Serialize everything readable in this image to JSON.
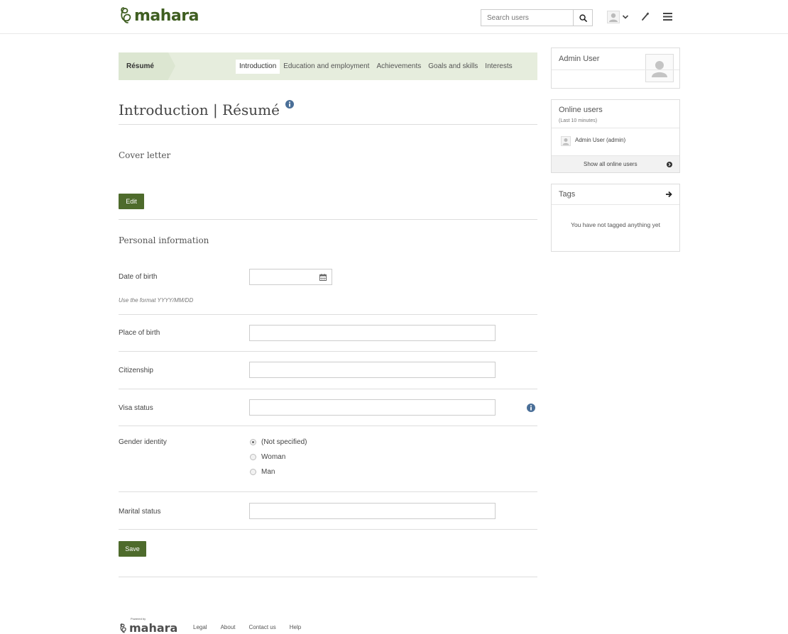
{
  "brand": {
    "name": "mahara",
    "color": "#3f5e21",
    "footer_powered_by": "Powered by",
    "footer_name": "mahara"
  },
  "header": {
    "search_placeholder": "Search users",
    "icons": [
      "search-icon",
      "user-icon",
      "chevron-down-icon",
      "wrench-icon",
      "menu-icon"
    ]
  },
  "resume_nav": {
    "label": "Résumé",
    "tabs": [
      {
        "label": "Introduction",
        "active": true
      },
      {
        "label": "Education and employment",
        "active": false
      },
      {
        "label": "Achievements",
        "active": false
      },
      {
        "label": "Goals and skills",
        "active": false
      },
      {
        "label": "Interests",
        "active": false
      }
    ]
  },
  "main": {
    "title": "Introduction | Résumé",
    "cover_letter": {
      "heading": "Cover letter",
      "edit_label": "Edit"
    },
    "personal_info": {
      "heading": "Personal information",
      "date_of_birth": {
        "label": "Date of birth",
        "value": "",
        "hint": "Use the format YYYY/MM/DD"
      },
      "place_of_birth": {
        "label": "Place of birth",
        "value": ""
      },
      "citizenship": {
        "label": "Citizenship",
        "value": ""
      },
      "visa_status": {
        "label": "Visa status",
        "value": ""
      },
      "gender_identity": {
        "label": "Gender identity",
        "options": [
          {
            "label": "(Not specified)",
            "checked": true
          },
          {
            "label": "Woman",
            "checked": false
          },
          {
            "label": "Man",
            "checked": false
          }
        ]
      },
      "marital_status": {
        "label": "Marital status",
        "value": ""
      },
      "save_label": "Save"
    }
  },
  "sidebar": {
    "profile": {
      "name": "Admin User"
    },
    "online_users": {
      "title": "Online users",
      "subtitle": "(Last 10 minutes)",
      "users": [
        {
          "name": "Admin User (admin)"
        }
      ],
      "show_all_label": "Show all online users"
    },
    "tags": {
      "title": "Tags",
      "empty_message": "You have not tagged anything yet"
    }
  },
  "footer": {
    "links": [
      "Legal",
      "About",
      "Contact us",
      "Help"
    ]
  },
  "colors": {
    "accent": "#4e6b2c",
    "nav_bg": "#e6eddd",
    "border": "#dddddd"
  }
}
